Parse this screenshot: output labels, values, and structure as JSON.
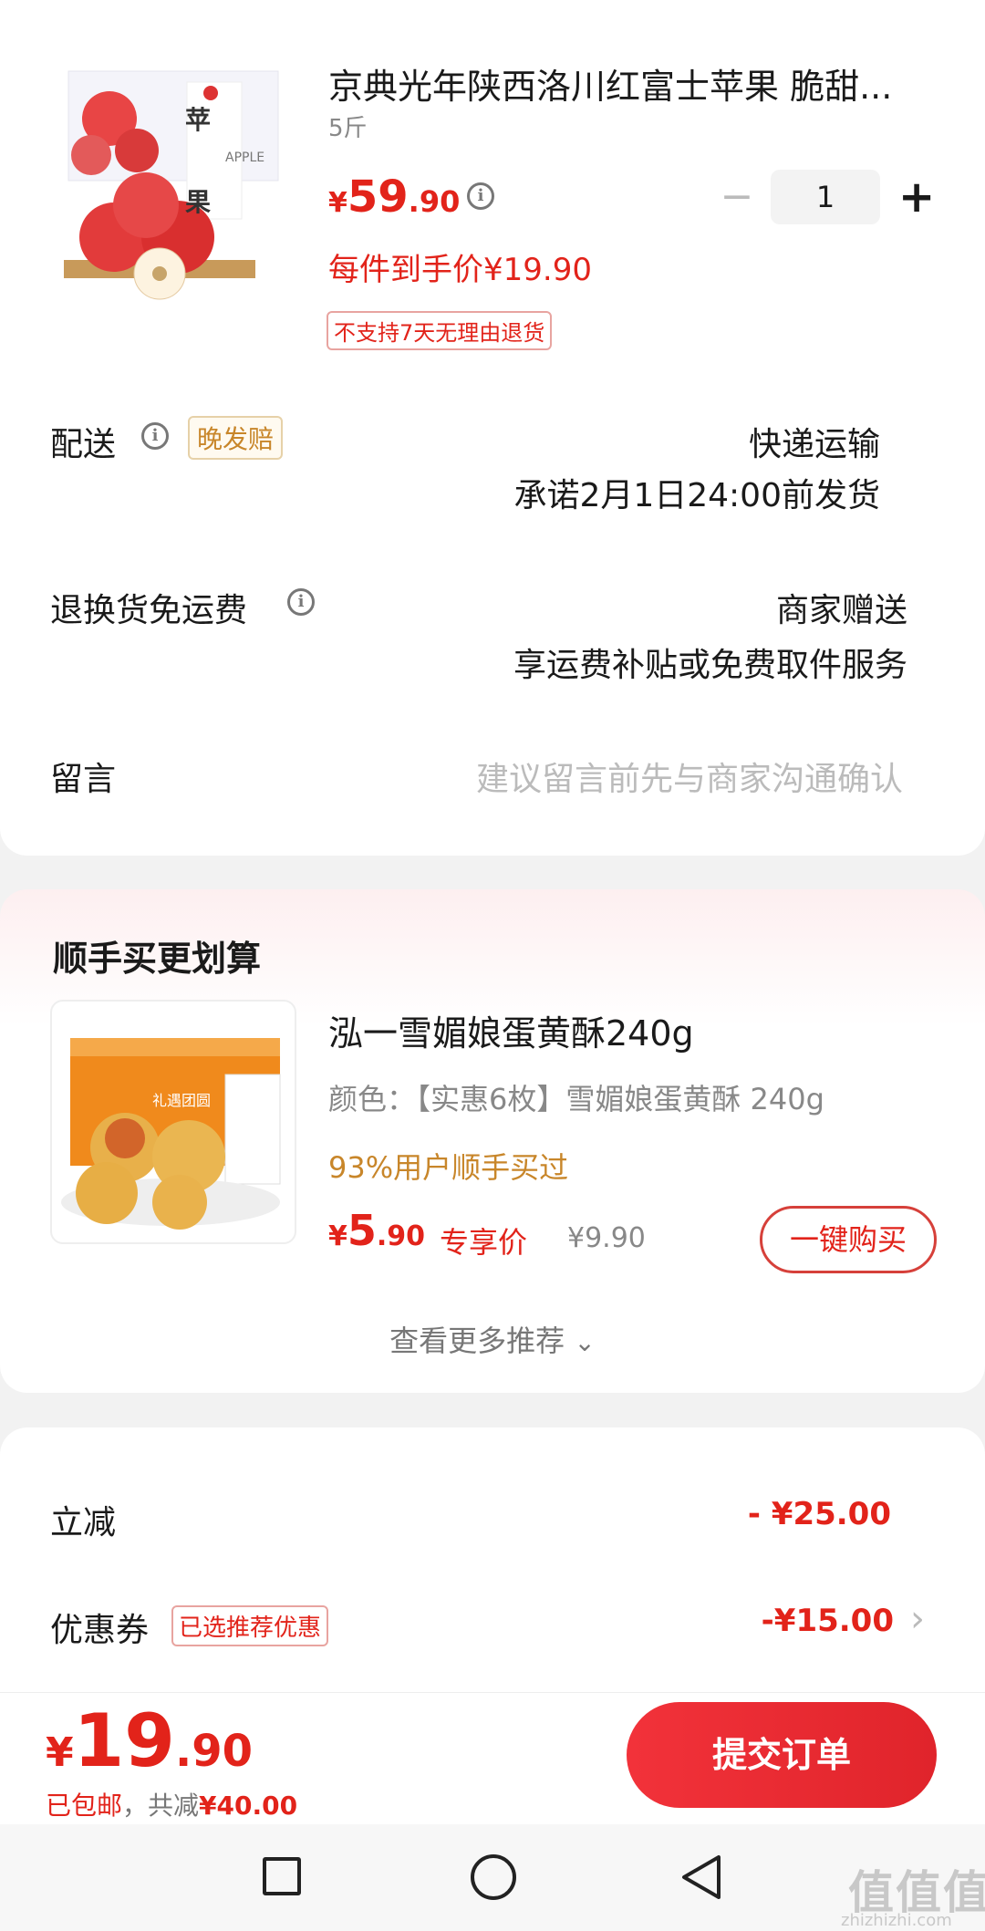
{
  "product": {
    "title": "京典光年陕西洛川红富士苹果 脆甜...",
    "spec": "5斤",
    "image_text_main": "苹",
    "image_text_sub": "果",
    "image_text_latin": "APPLE",
    "price_symbol": "¥",
    "price_int": "59",
    "price_dec": ".90",
    "info_glyph": "i",
    "qty_minus": "−",
    "qty": "1",
    "qty_plus": "+",
    "per_unit": "每件到手价¥19.90",
    "return_tag": "不支持7天无理由退货"
  },
  "delivery": {
    "label": "配送",
    "tag": "晚发赔",
    "method": "快递运输",
    "promise": "承诺2月1日24:00前发货"
  },
  "return_shipping": {
    "label": "退换货免运费",
    "value1": "商家赠送",
    "value2": "享运费补贴或免费取件服务"
  },
  "message": {
    "label": "留言",
    "placeholder": "建议留言前先与商家沟通确认"
  },
  "addon": {
    "section_title": "顺手买更划算",
    "title": "泓一雪媚娘蛋黄酥240g",
    "color": "颜色：【实惠6枚】雪媚娘蛋黄酥 240g",
    "buy_rate": "93%用户顺手买过",
    "price_symbol": "¥",
    "price_int": "5",
    "price_dec": ".90",
    "exclusive": "专享价",
    "old_price": "¥9.90",
    "buy_button": "一键购买",
    "more": "查看更多推荐",
    "more_chevron": "⌄",
    "box_label": "礼遇团圆"
  },
  "discounts": {
    "instant_label": "立减",
    "instant_value": "- ¥25.00",
    "coupon_label": "优惠券",
    "coupon_tag": "已选推荐优惠",
    "coupon_value": "-¥15.00",
    "coupon_chevron": "›"
  },
  "footer": {
    "total_symbol": "¥",
    "total_int": "19",
    "total_dec": ".90",
    "shipping": "已包邮",
    "sep": "，共减",
    "saved": "¥40.00",
    "submit": "提交订单"
  },
  "watermark": {
    "main": "值值值",
    "sub": "zhizhizhi.com"
  },
  "colors": {
    "accent_red": "#e2231a",
    "gold": "#c8862a"
  }
}
